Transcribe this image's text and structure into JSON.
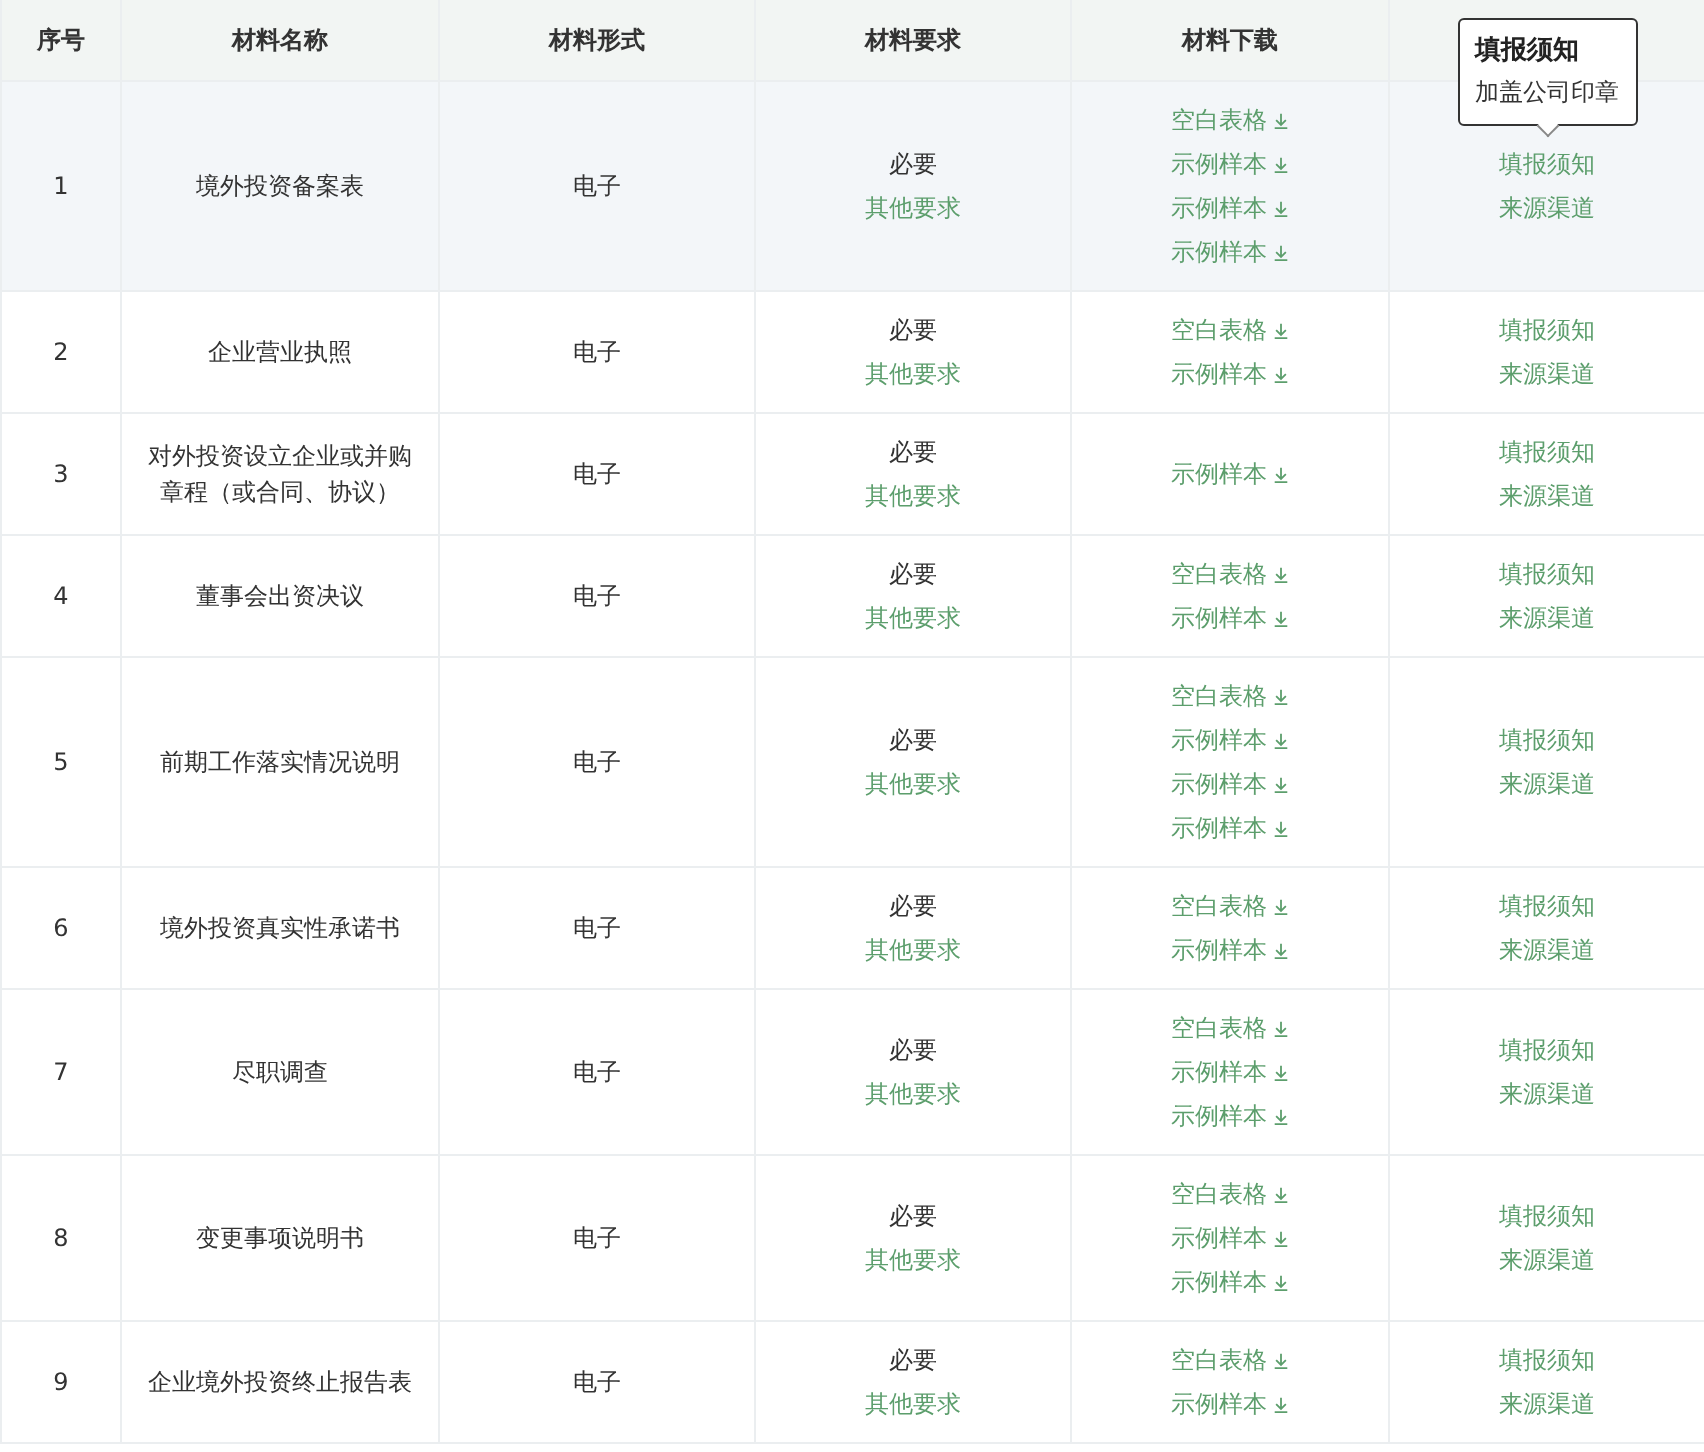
{
  "table": {
    "columns": [
      "序号",
      "材料名称",
      "材料形式",
      "材料要求",
      "材料下载"
    ],
    "rows": [
      {
        "index": "1",
        "name": "境外投资备案表",
        "form": "电子",
        "requirement": "必要",
        "other": "其他要求",
        "hovered": true,
        "downloads": [
          "空白表格",
          "示例样本",
          "示例样本",
          "示例样本"
        ],
        "notes": [
          "填报须知",
          "来源渠道"
        ],
        "tooltip": {
          "title": "填报须知",
          "text": "加盖公司印章"
        }
      },
      {
        "index": "2",
        "name": "企业营业执照",
        "form": "电子",
        "requirement": "必要",
        "other": "其他要求",
        "hovered": false,
        "downloads": [
          "空白表格",
          "示例样本"
        ],
        "notes": [
          "填报须知",
          "来源渠道"
        ]
      },
      {
        "index": "3",
        "name": "对外投资设立企业或并购章程（或合同、协议）",
        "form": "电子",
        "requirement": "必要",
        "other": "其他要求",
        "hovered": false,
        "downloads": [
          "示例样本"
        ],
        "notes": [
          "填报须知",
          "来源渠道"
        ]
      },
      {
        "index": "4",
        "name": "董事会出资决议",
        "form": "电子",
        "requirement": "必要",
        "other": "其他要求",
        "hovered": false,
        "downloads": [
          "空白表格",
          "示例样本"
        ],
        "notes": [
          "填报须知",
          "来源渠道"
        ]
      },
      {
        "index": "5",
        "name": "前期工作落实情况说明",
        "form": "电子",
        "requirement": "必要",
        "other": "其他要求",
        "hovered": false,
        "downloads": [
          "空白表格",
          "示例样本",
          "示例样本",
          "示例样本"
        ],
        "notes": [
          "填报须知",
          "来源渠道"
        ]
      },
      {
        "index": "6",
        "name": "境外投资真实性承诺书",
        "form": "电子",
        "requirement": "必要",
        "other": "其他要求",
        "hovered": false,
        "downloads": [
          "空白表格",
          "示例样本"
        ],
        "notes": [
          "填报须知",
          "来源渠道"
        ]
      },
      {
        "index": "7",
        "name": "尽职调查",
        "form": "电子",
        "requirement": "必要",
        "other": "其他要求",
        "hovered": false,
        "downloads": [
          "空白表格",
          "示例样本",
          "示例样本"
        ],
        "notes": [
          "填报须知",
          "来源渠道"
        ]
      },
      {
        "index": "8",
        "name": "变更事项说明书",
        "form": "电子",
        "requirement": "必要",
        "other": "其他要求",
        "hovered": false,
        "downloads": [
          "空白表格",
          "示例样本",
          "示例样本"
        ],
        "notes": [
          "填报须知",
          "来源渠道"
        ]
      },
      {
        "index": "9",
        "name": "企业境外投资终止报告表",
        "form": "电子",
        "requirement": "必要",
        "other": "其他要求",
        "hovered": false,
        "downloads": [
          "空白表格",
          "示例样本"
        ],
        "notes": [
          "填报须知",
          "来源渠道"
        ]
      }
    ]
  }
}
